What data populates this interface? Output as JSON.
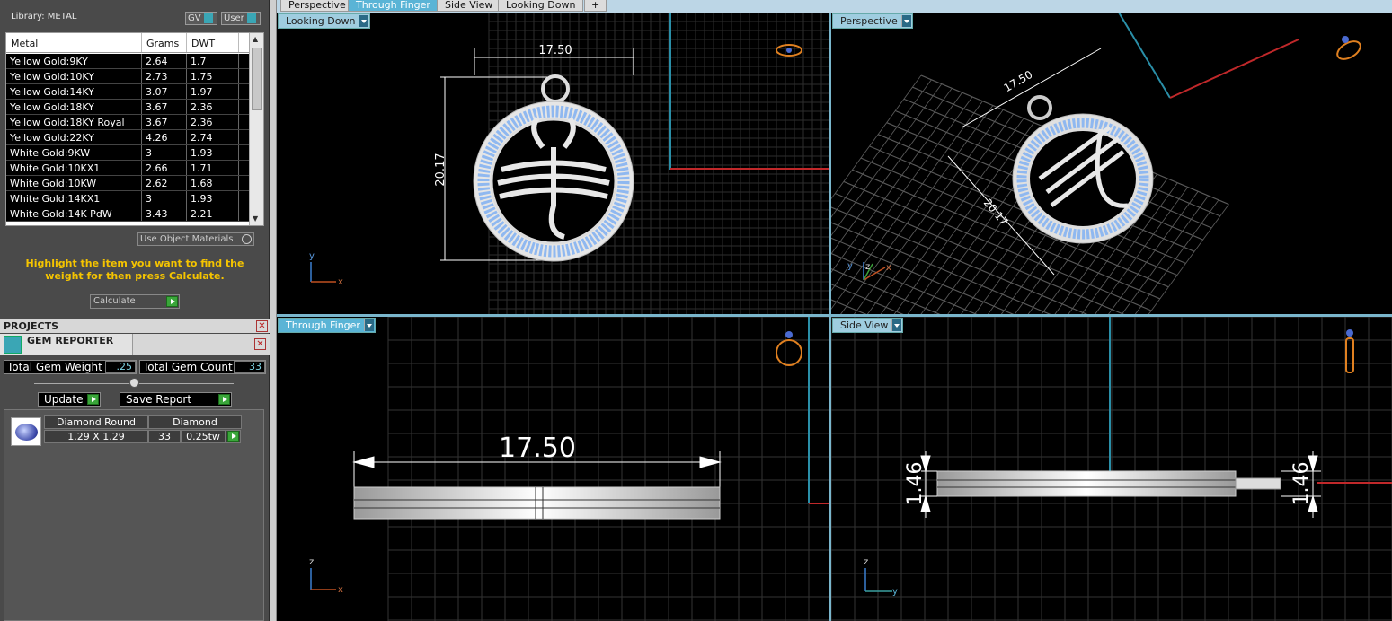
{
  "library": {
    "label": "Library: METAL",
    "gv_label": "GV",
    "user_label": "User",
    "columns": [
      "Metal",
      "Grams",
      "DWT"
    ],
    "rows": [
      [
        "Yellow Gold:9KY",
        "2.64",
        "1.7"
      ],
      [
        "Yellow Gold:10KY",
        "2.73",
        "1.75"
      ],
      [
        "Yellow Gold:14KY",
        "3.07",
        "1.97"
      ],
      [
        "Yellow Gold:18KY",
        "3.67",
        "2.36"
      ],
      [
        "Yellow Gold:18KY Royal",
        "3.67",
        "2.36"
      ],
      [
        "Yellow Gold:22KY",
        "4.26",
        "2.74"
      ],
      [
        "White Gold:9KW",
        "3",
        "1.93"
      ],
      [
        "White Gold:10KX1",
        "2.66",
        "1.71"
      ],
      [
        "White Gold:10KW",
        "2.62",
        "1.68"
      ],
      [
        "White Gold:14KX1",
        "3",
        "1.93"
      ],
      [
        "White Gold:14K PdW",
        "3.43",
        "2.21"
      ]
    ],
    "use_object_materials": "Use Object Materials",
    "hint": "Highlight the item you want to find the weight for then press Calculate.",
    "calculate_label": "Calculate"
  },
  "projects": {
    "label": "PROJECTS"
  },
  "gem_reporter": {
    "title": "GEM REPORTER",
    "total_weight_label": "Total Gem Weight",
    "total_weight_value": ".25",
    "total_count_label": "Total Gem Count",
    "total_count_value": "33",
    "update_label": "Update",
    "save_report_label": "Save Report",
    "gem": {
      "shape": "Diamond Round",
      "size": "1.29 X 1.29",
      "material": "Diamond",
      "count": "33",
      "weight": "0.25tw"
    }
  },
  "tabs": [
    "Perspective",
    "Through Finger",
    "Side View",
    "Looking Down",
    "+"
  ],
  "active_tab": "Through Finger",
  "viewports": {
    "top_left": {
      "label": "Looking Down",
      "dim_width": "17.50",
      "dim_height": "20.17"
    },
    "top_right": {
      "label": "Perspective",
      "dim_width": "17.50",
      "dim_height": "20.17"
    },
    "bottom_left": {
      "label": "Through Finger",
      "dim_width": "17.50"
    },
    "bottom_right": {
      "label": "Side View",
      "dim_left": "1.46",
      "dim_right": "1.46"
    }
  },
  "colors": {
    "accent": "#5ab4d6",
    "grid": "#3a3a3a",
    "gem_blue": "#8fb8f0",
    "hint_yellow": "#f5c400",
    "axis_red": "#c0282a",
    "axis_cyan": "#2a8fa8"
  }
}
